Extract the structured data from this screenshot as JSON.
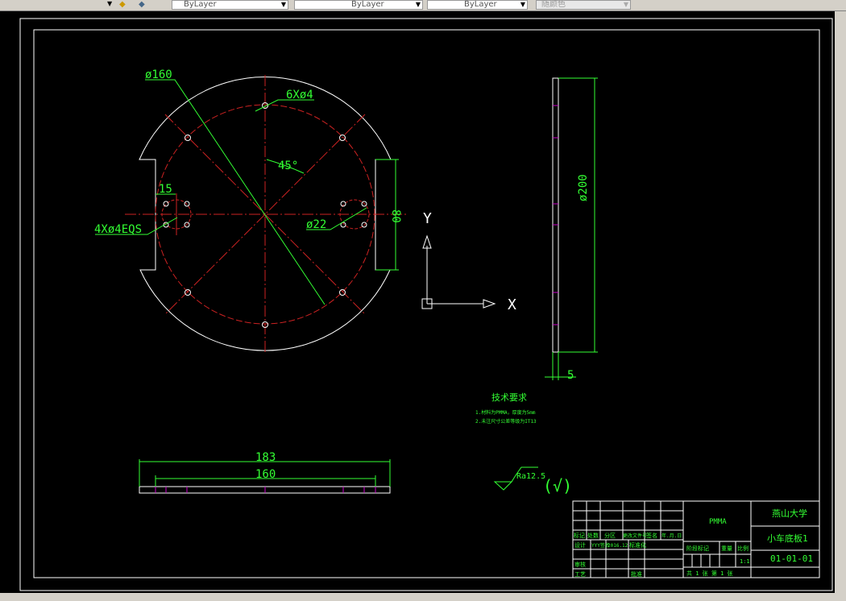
{
  "toolbar": {
    "layer_color": "ByLayer",
    "linetype": "ByLayer",
    "lineweight": "ByLayer",
    "plot_style": "随颜色"
  },
  "drawing": {
    "dims": {
      "dia160": "ø160",
      "holes6": "6Xø4",
      "angle": "45°",
      "d15": "15",
      "holes4": "4Xø4EQS",
      "dia22": "ø22",
      "d80": "80",
      "dia200": "ø200",
      "thick5": "5",
      "len183": "183",
      "len160": "160"
    },
    "ucs": {
      "x": "X",
      "y": "Y"
    },
    "tech": {
      "title": "技术要求",
      "line1": "1.材料为PMMA，厚度为5mm",
      "line2": "2.未注尺寸公差等级为IT13"
    },
    "roughness": {
      "value": "Ra12.5",
      "other": "(√)"
    }
  },
  "title_block": {
    "rev": [
      "标记",
      "处数",
      "分区",
      "更改文件号",
      "签名",
      "年.月.日"
    ],
    "design": "设计",
    "designer": "YYY签名",
    "date": "2016.12",
    "standard": "标准化",
    "review": "审核",
    "process": "工艺",
    "approve": "批准",
    "material": "PMMA",
    "stage": "阶段标记",
    "weight": "重量",
    "scale_label": "比例",
    "scale": "1:1",
    "sheets": "共 1 张  第 1 张",
    "school": "燕山大学",
    "name": "小车底板1",
    "code": "01-01-01"
  }
}
